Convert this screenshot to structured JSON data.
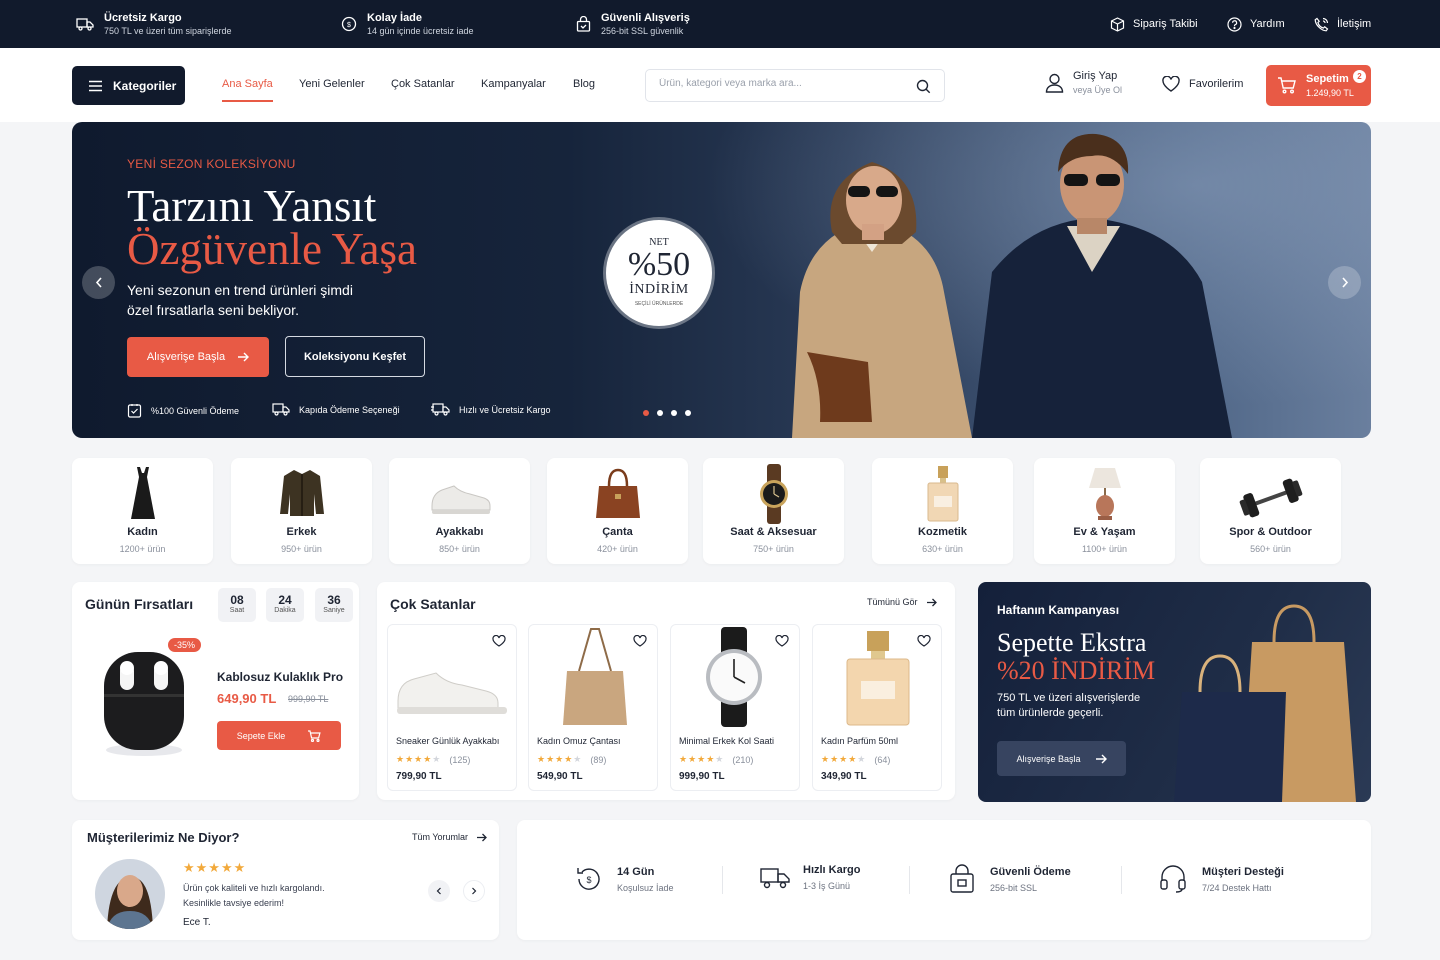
{
  "topbar": {
    "shipping_title": "Ücretsiz Kargo",
    "shipping_sub": "750 TL ve üzeri tüm siparişlerde",
    "return_title": "Kolay İade",
    "return_sub": "14 gün içinde ücretsiz iade",
    "secure_title": "Güvenli Alışveriş",
    "secure_sub": "256-bit SSL güvenlik",
    "order_tracking": "Sipariş Takibi",
    "help": "Yardım",
    "contact": "İletişim"
  },
  "header": {
    "categories_label": "Kategoriler",
    "nav": [
      "Ana Sayfa",
      "Yeni Gelenler",
      "Çok Satanlar",
      "Kampanyalar",
      "Blog"
    ],
    "search_placeholder": "Ürün, kategori veya marka ara...",
    "login": "Giriş Yap",
    "register": "veya Üye Ol",
    "favorites": "Favorilerim",
    "cart_label": "Sepetim",
    "cart_total": "1.249,90 TL",
    "cart_count": "2"
  },
  "hero": {
    "eyebrow": "YENİ SEZON KOLEKSİYONU",
    "title_line1": "Tarzını Yansıt",
    "title_line2": "Özgüvenle Yaşa",
    "subtitle_line1": "Yeni sezonun en trend ürünleri şimdi",
    "subtitle_line2": "özel fırsatlarla seni bekliyor.",
    "primary_button": "Alışverişe Başla",
    "secondary_button": "Koleksiyonu Keşfet",
    "badge_top": "NET",
    "badge_value": "%50",
    "badge_label": "İNDİRİM",
    "badge_sub": "SEÇİLİ ÜRÜNLERDE",
    "features": [
      "%100 Güvenli Ödeme",
      "Kapıda Ödeme Seçeneği",
      "Hızlı ve Ücretsiz Kargo"
    ],
    "slide_count": 4,
    "active_slide": 1
  },
  "categories": [
    {
      "name": "Kadın",
      "count": "1200+ ürün",
      "icon": "dress-icon"
    },
    {
      "name": "Erkek",
      "count": "950+ ürün",
      "icon": "jacket-icon"
    },
    {
      "name": "Ayakkabı",
      "count": "850+ ürün",
      "icon": "sneaker-icon"
    },
    {
      "name": "Çanta",
      "count": "420+ ürün",
      "icon": "handbag-icon"
    },
    {
      "name": "Saat & Aksesuar",
      "count": "750+ ürün",
      "icon": "watch-icon"
    },
    {
      "name": "Kozmetik",
      "count": "630+ ürün",
      "icon": "perfume-icon"
    },
    {
      "name": "Ev & Yaşam",
      "count": "1100+ ürün",
      "icon": "lamp-icon"
    },
    {
      "name": "Spor & Outdoor",
      "count": "560+ ürün",
      "icon": "dumbbell-icon"
    }
  ],
  "deals": {
    "title": "Günün Fırsatları",
    "hours": "08",
    "hours_label": "Saat",
    "minutes": "24",
    "minutes_label": "Dakika",
    "seconds": "36",
    "seconds_label": "Saniye",
    "discount": "-35%",
    "product_name": "Kablosuz Kulaklık Pro",
    "price": "649,90 TL",
    "old_price": "999,90 TL",
    "add_to_cart": "Sepete Ekle"
  },
  "bestsellers": {
    "title": "Çok Satanlar",
    "see_all": "Tümünü Gör",
    "products": [
      {
        "name": "Sneaker Günlük Ayakkabı",
        "reviews": "(125)",
        "price": "799,90 TL",
        "rating": 4
      },
      {
        "name": "Kadın Omuz Çantası",
        "reviews": "(89)",
        "price": "549,90 TL",
        "rating": 4
      },
      {
        "name": "Minimal Erkek Kol Saati",
        "reviews": "(210)",
        "price": "999,90 TL",
        "rating": 4
      },
      {
        "name": "Kadın Parfüm 50ml",
        "reviews": "(64)",
        "price": "349,90 TL",
        "rating": 4
      }
    ]
  },
  "campaign": {
    "eyebrow": "Haftanın Kampanyası",
    "title_line1": "Sepette Ekstra",
    "title_line2": "%20 İNDİRİM",
    "desc_line1": "750 TL ve üzeri alışverişlerde",
    "desc_line2": "tüm ürünlerde geçerli.",
    "button": "Alışverişe Başla"
  },
  "reviews": {
    "title": "Müşterilerimiz Ne Diyor?",
    "all_link": "Tüm Yorumlar",
    "rating": 5,
    "text_line1": "Ürün çok kaliteli ve hızlı kargolandı.",
    "text_line2": "Kesinlikle tavsiye ederim!",
    "author": "Ece T."
  },
  "features": [
    {
      "title": "14 Gün",
      "sub": "Koşulsuz İade",
      "icon": "return-icon"
    },
    {
      "title": "Hızlı Kargo",
      "sub": "1-3 İş Günü",
      "icon": "truck-icon"
    },
    {
      "title": "Güvenli Ödeme",
      "sub": "256-bit SSL",
      "icon": "secure-bag-icon"
    },
    {
      "title": "Müşteri Desteği",
      "sub": "7/24 Destek Hattı",
      "icon": "headset-icon"
    }
  ],
  "colors": {
    "navy": "#111a2c",
    "accent": "#e85a45",
    "star": "#f2a93b"
  }
}
